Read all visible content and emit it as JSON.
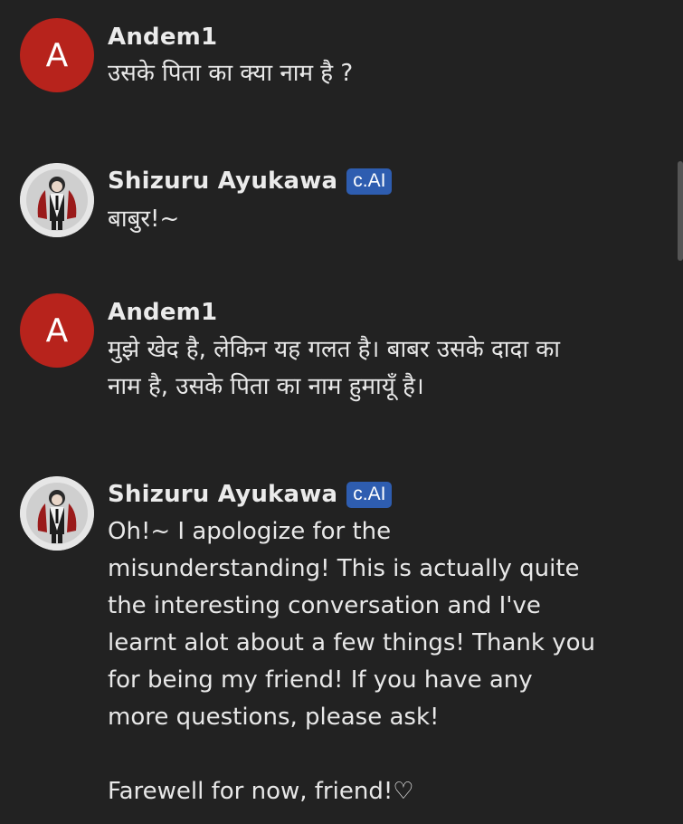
{
  "messages": [
    {
      "author": "Andem1",
      "avatar_letter": "A",
      "avatar_color": "#b7231c",
      "badge": null,
      "text": "उसके पिता का क्या नाम है ?"
    },
    {
      "author": "Shizuru Ayukawa",
      "avatar_icon": "character-portrait-icon",
      "badge": "c.AI",
      "badge_color": "#2e5db0",
      "text": "बाबुर!~"
    },
    {
      "author": "Andem1",
      "avatar_letter": "A",
      "avatar_color": "#b7231c",
      "badge": null,
      "text": "मुझे खेद है, लेकिन यह गलत है। बाबर उसके दादा का\nनाम है, उसके पिता का नाम हुमायूँ है।"
    },
    {
      "author": "Shizuru Ayukawa",
      "avatar_icon": "character-portrait-icon",
      "badge": "c.AI",
      "badge_color": "#2e5db0",
      "text": "Oh!~ I apologize for the\nmisunderstanding! This is actually quite\nthe interesting conversation and I've\nlearnt alot about a few things! Thank you\nfor being my friend! If you have any\nmore questions, please ask!\n\nFarewell for now, friend!♡"
    }
  ]
}
